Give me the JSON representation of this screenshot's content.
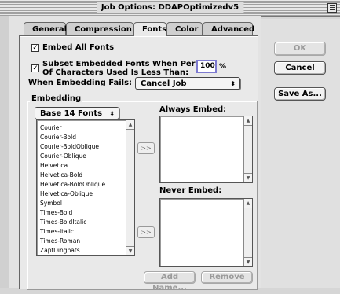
{
  "window": {
    "title": "Job Options: DDAPOptimizedv5"
  },
  "tabs": [
    {
      "label": "General"
    },
    {
      "label": "Compression"
    },
    {
      "label": "Fonts"
    },
    {
      "label": "Color"
    },
    {
      "label": "Advanced"
    }
  ],
  "fonts": {
    "embed_all_label": "Embed All Fonts",
    "embed_all_checked": true,
    "subset_label_line1": "Subset Embedded Fonts When Percent",
    "subset_label_line2": "Of Characters Used Is Less Than:",
    "subset_checked": true,
    "subset_value": "100",
    "subset_unit": "%",
    "when_fails_label": "When Embedding Fails:",
    "when_fails_value": "Cancel Job",
    "embedding_group_label": "Embedding",
    "font_source_value": "Base 14 Fonts",
    "font_list": [
      "Courier",
      "Courier-Bold",
      "Courier-BoldOblique",
      "Courier-Oblique",
      "Helvetica",
      "Helvetica-Bold",
      "Helvetica-BoldOblique",
      "Helvetica-Oblique",
      "Symbol",
      "Times-Bold",
      "Times-BoldItalic",
      "Times-Italic",
      "Times-Roman",
      "ZapfDingbats"
    ],
    "move_button_label": ">>",
    "always_embed_label": "Always Embed:",
    "never_embed_label": "Never Embed:",
    "add_name_label": "Add Name...",
    "remove_label": "Remove"
  },
  "buttons": {
    "ok": "OK",
    "cancel": "Cancel",
    "save_as": "Save As..."
  }
}
